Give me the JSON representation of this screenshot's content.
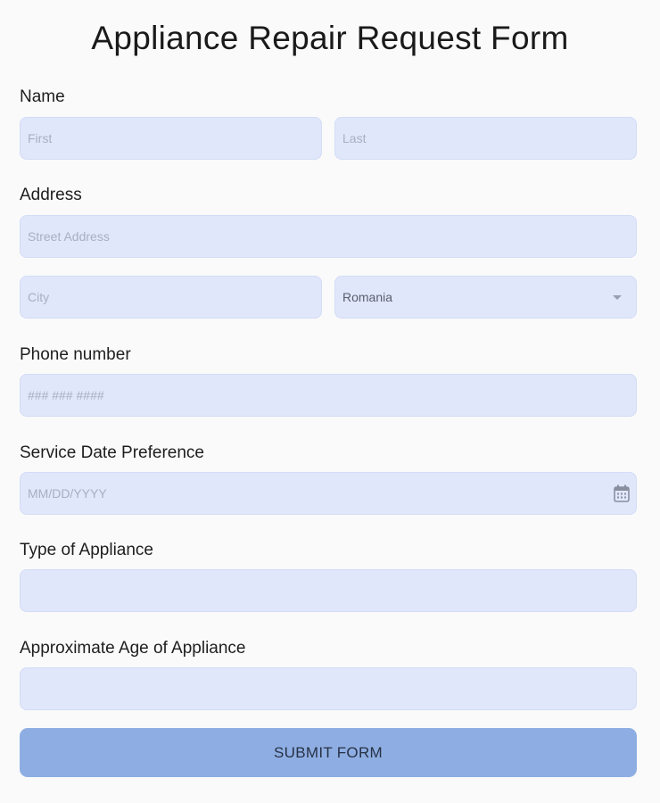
{
  "form": {
    "title": "Appliance Repair Request Form",
    "name": {
      "label": "Name",
      "first_placeholder": "First",
      "last_placeholder": "Last"
    },
    "address": {
      "label": "Address",
      "street_placeholder": "Street Address",
      "city_placeholder": "City",
      "country_value": "Romania"
    },
    "phone": {
      "label": "Phone number",
      "placeholder": "### ### ####"
    },
    "service_date": {
      "label": "Service Date Preference",
      "placeholder": "MM/DD/YYYY",
      "icon": "calendar-icon"
    },
    "appliance_type": {
      "label": "Type of Appliance",
      "value": ""
    },
    "appliance_age": {
      "label": "Approximate Age of Appliance",
      "value": ""
    },
    "submit_label": "SUBMIT FORM"
  },
  "colors": {
    "background": "#fafafa",
    "field_fill": "#e0e7fb",
    "submit_fill": "#8eaee3",
    "submit_text": "#283145"
  }
}
